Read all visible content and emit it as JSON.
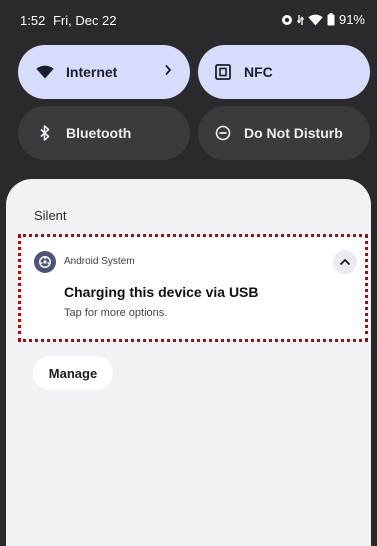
{
  "status_bar": {
    "time": "1:52",
    "date": "Fri, Dec 22",
    "battery": "91%"
  },
  "quick_settings": {
    "tiles": [
      {
        "label": "Internet",
        "active": true,
        "icon": "wifi-icon"
      },
      {
        "label": "NFC",
        "active": true,
        "icon": "nfc-icon"
      },
      {
        "label": "Bluetooth",
        "active": false,
        "icon": "bluetooth-icon"
      },
      {
        "label": "Do Not Disturb",
        "active": false,
        "icon": "do-not-disturb-icon"
      }
    ]
  },
  "notifications": {
    "section_label": "Silent",
    "items": [
      {
        "app_name": "Android System",
        "title": "Charging this device via USB",
        "text": "Tap for more options."
      }
    ],
    "manage_label": "Manage"
  },
  "colors": {
    "tile_active": "#d6ddfb",
    "tile_inactive": "#3b3b3f",
    "shade_background": "#f2f1f6",
    "highlight_outline": "#a00e0e"
  }
}
